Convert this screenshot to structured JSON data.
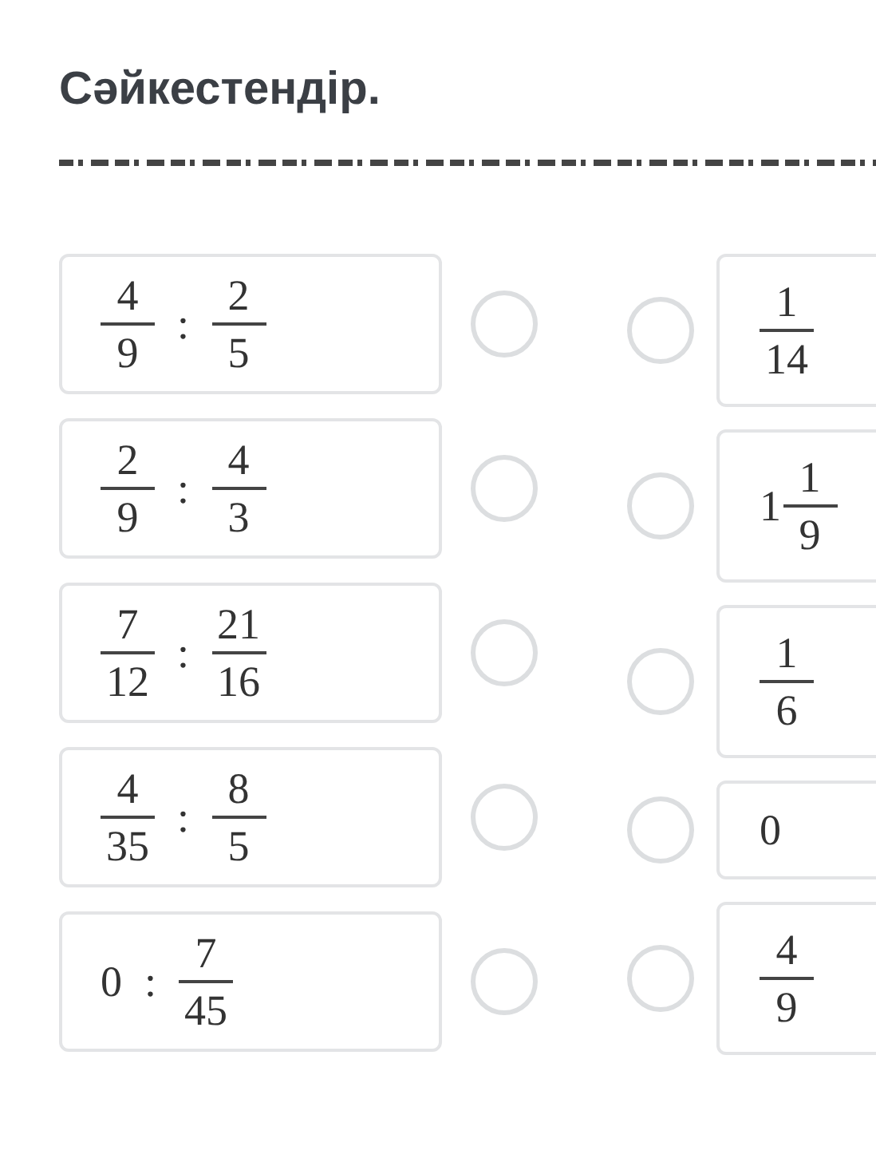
{
  "title": "Сәйкестендір.",
  "left_items": [
    {
      "selected": false,
      "terms": [
        {
          "kind": "fraction",
          "numerator": "4",
          "denominator": "9"
        },
        {
          "kind": "colon",
          "text": ":"
        },
        {
          "kind": "fraction",
          "numerator": "2",
          "denominator": "5"
        }
      ]
    },
    {
      "selected": false,
      "terms": [
        {
          "kind": "fraction",
          "numerator": "2",
          "denominator": "9"
        },
        {
          "kind": "colon",
          "text": ":"
        },
        {
          "kind": "fraction",
          "numerator": "4",
          "denominator": "3"
        }
      ]
    },
    {
      "selected": false,
      "terms": [
        {
          "kind": "fraction",
          "numerator": "7",
          "denominator": "12"
        },
        {
          "kind": "colon",
          "text": ":"
        },
        {
          "kind": "fraction",
          "numerator": "21",
          "denominator": "16"
        }
      ]
    },
    {
      "selected": false,
      "terms": [
        {
          "kind": "fraction",
          "numerator": "4",
          "denominator": "35"
        },
        {
          "kind": "colon",
          "text": ":"
        },
        {
          "kind": "fraction",
          "numerator": "8",
          "denominator": "5"
        }
      ]
    },
    {
      "selected": false,
      "terms": [
        {
          "kind": "number",
          "text": "0"
        },
        {
          "kind": "colon",
          "text": ":"
        },
        {
          "kind": "fraction",
          "numerator": "7",
          "denominator": "45"
        }
      ]
    }
  ],
  "right_items": [
    {
      "selected": false,
      "terms": [
        {
          "kind": "fraction",
          "numerator": "1",
          "denominator": "14"
        }
      ]
    },
    {
      "selected": false,
      "terms": [
        {
          "kind": "number",
          "text": "1"
        },
        {
          "kind": "fraction",
          "numerator": "1",
          "denominator": "9"
        }
      ]
    },
    {
      "selected": false,
      "terms": [
        {
          "kind": "fraction",
          "numerator": "1",
          "denominator": "6"
        }
      ]
    },
    {
      "selected": false,
      "terms": [
        {
          "kind": "number",
          "text": "0"
        }
      ]
    },
    {
      "selected": false,
      "terms": [
        {
          "kind": "fraction",
          "numerator": "4",
          "denominator": "9"
        }
      ]
    }
  ]
}
